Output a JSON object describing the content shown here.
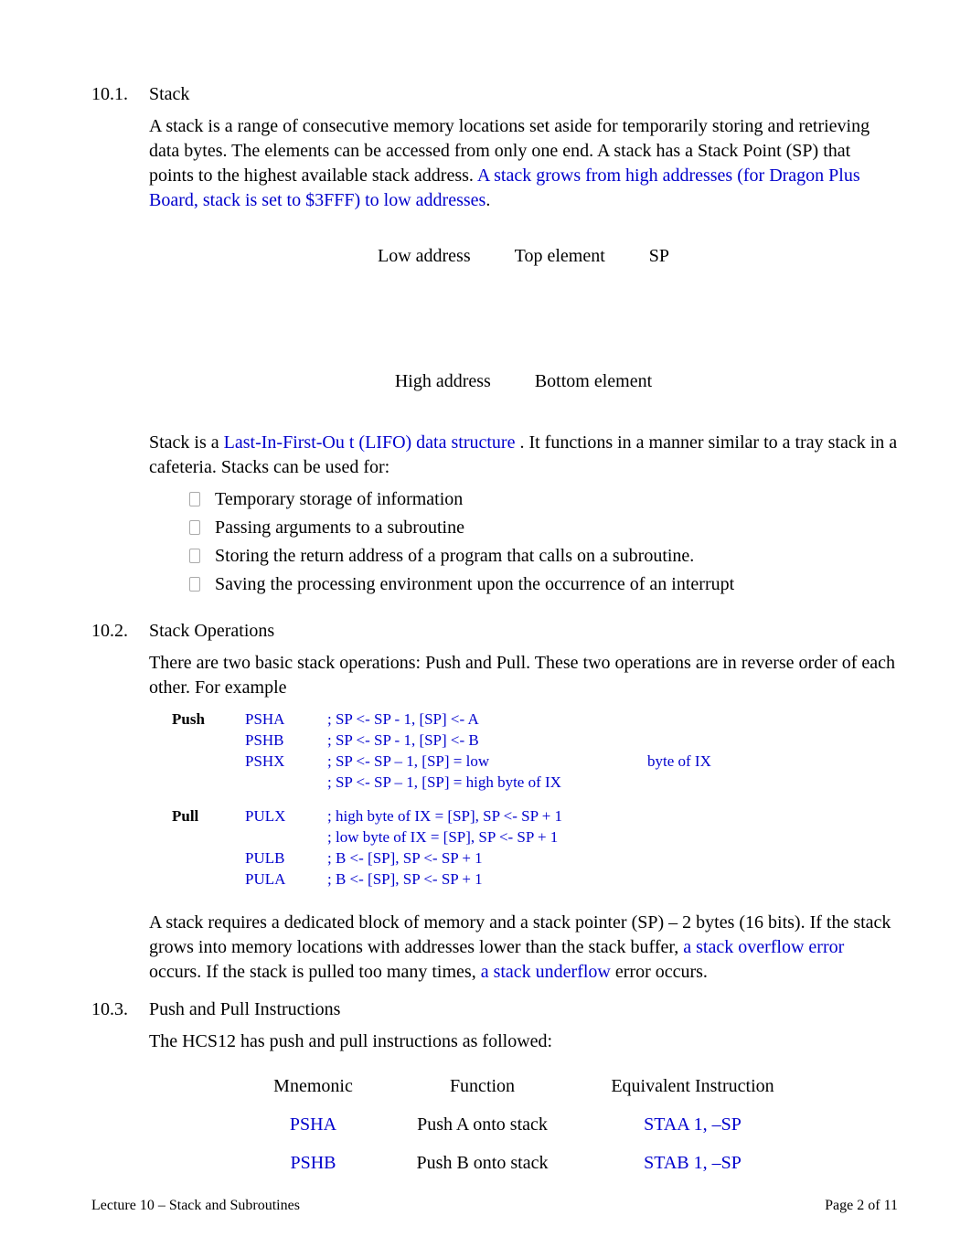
{
  "s1": {
    "num": "10.1.",
    "title": "Stack",
    "p1a": "A stack is a range of consecutive memory locations set aside for temporarily storing and retrieving data bytes. The elements can be accessed from only one end. A stack has a Stack Point (SP) that points to the highest available stack address. ",
    "p1b": "A stack grows from high addresses (for Dragon Plus Board, stack is set to  $3FFF)  to low addresses",
    "p1c": ".",
    "diag": {
      "low": "Low address",
      "top": "Top element",
      "sp": "SP",
      "high": "High address",
      "bottom": "Bottom element"
    },
    "p2a": "Stack is a ",
    "p2b": "Last-In-First-Ou  t (LIFO) data structure ",
    "p2c": ". It functions in a manner similar to a tray stack in a cafeteria. Stacks can be used for:",
    "bullets": [
      "Temporary storage of information",
      "Passing arguments to a subroutine",
      "Storing the return address of a program that calls on a subroutine.",
      "Saving the processing environment upon the occurrence of an interrupt"
    ]
  },
  "s2": {
    "num": "10.2.",
    "title": "Stack Operations",
    "p1": "There are two basic stack operations: Push  and Pull. These two operations are in reverse order of each other.  For example",
    "rows": [
      {
        "c1": "Push",
        "c2": "PSHA",
        "c3": "; SP <- SP - 1, [SP] <- A",
        "c4": ""
      },
      {
        "c1": "",
        "c2": "PSHB",
        "c3": "; SP <- SP - 1, [SP] <- B",
        "c4": ""
      },
      {
        "c1": "",
        "c2": "PSHX",
        "c3": "; SP <- SP – 1, [SP] = low",
        "c4": "byte of IX"
      },
      {
        "c1": "",
        "c2": "",
        "c3": "; SP <- SP – 1, [SP] = high byte of IX",
        "c4": ""
      },
      {
        "gap": true
      },
      {
        "c1": "Pull",
        "c2": "PULX",
        "c3": "; high byte of IX = [SP], SP <- SP + 1",
        "c4": ""
      },
      {
        "c1": "",
        "c2": "",
        "c3": "; low byte of IX = [SP], SP <- SP + 1",
        "c4": ""
      },
      {
        "c1": "",
        "c2": "PULB",
        "c3": "; B <- [SP], SP <- SP + 1",
        "c4": ""
      },
      {
        "c1": "",
        "c2": "PULA",
        "c3": "; B <- [SP], SP <- SP + 1",
        "c4": ""
      }
    ],
    "p2a": "A stack requires a dedicated block of memory and a stack pointer (SP) – 2 bytes (16 bits). If the stack grows into memory locations with addresses lower than the stack buffer, ",
    "p2b": "a stack overflow error",
    "p2c": "  occurs. If the stack is pulled too many times, ",
    "p2d": "a stack underflow",
    "p2e": " error occurs."
  },
  "s3": {
    "num": "10.3.",
    "title": "Push and Pull Instructions",
    "p1": "The HCS12 has push and pull instructions as followed:",
    "header": {
      "m": "Mnemonic",
      "f": "Function",
      "e": "Equivalent Instruction"
    },
    "rows": [
      {
        "m": "PSHA",
        "f": "Push A onto stack",
        "e": "STAA  1, –SP"
      },
      {
        "m": "PSHB",
        "f": "Push B onto stack",
        "e": "STAB  1, –SP"
      }
    ]
  },
  "footer": {
    "left": "Lecture 10 – Stack and Subroutines",
    "right": "Page 2 of 11"
  }
}
